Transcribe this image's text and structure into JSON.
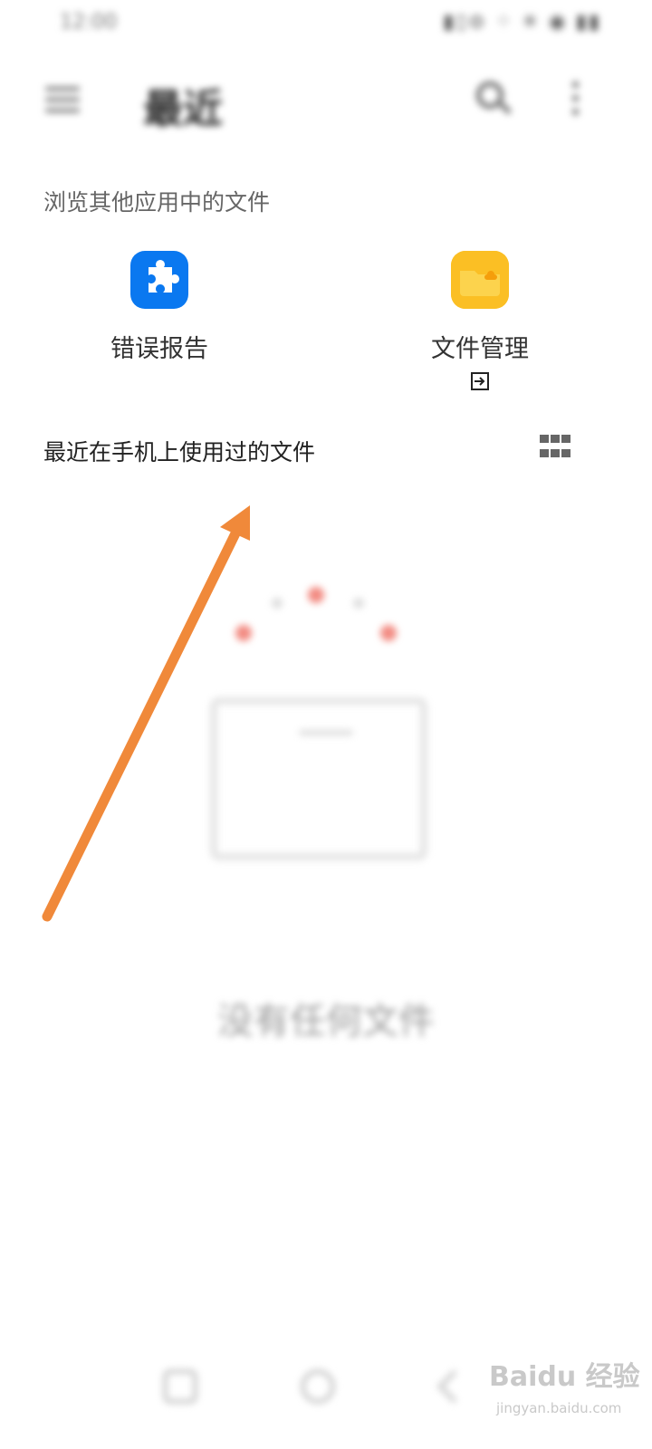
{
  "status_bar": {
    "time": "12:00",
    "icons_text": "▮▯⊜ ⁘ ✳ ◉ ▮▮"
  },
  "header": {
    "title": "最近"
  },
  "browse_section": {
    "title": "浏览其他应用中的文件",
    "apps": [
      {
        "label": "错误报告",
        "icon": "puzzle-icon",
        "color": "#0a78f0"
      },
      {
        "label": "文件管理",
        "icon": "folder-icon",
        "color": "#fbbf24"
      }
    ]
  },
  "recent_section": {
    "title": "最近在手机上使用过的文件"
  },
  "empty_state": {
    "text": "没有任何文件"
  },
  "watermark": {
    "brand": "Baidu 经验",
    "url": "jingyan.baidu.com"
  },
  "accent_arrow_color": "#f0893a"
}
